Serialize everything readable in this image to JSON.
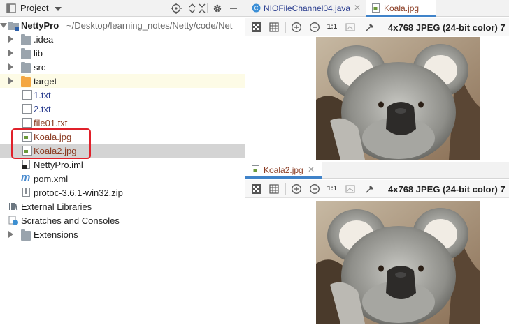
{
  "project_panel": {
    "title": "Project",
    "root_name": "NettyPro",
    "root_path": "~/Desktop/learning_notes/Netty/code/Net",
    "items": [
      {
        "label": "target",
        "kind": "folder-orange"
      },
      {
        "label": ".idea",
        "kind": "folder"
      },
      {
        "label": "lib",
        "kind": "folder"
      },
      {
        "label": "src",
        "kind": "folder"
      },
      {
        "label": "1.txt",
        "kind": "text"
      },
      {
        "label": "2.txt",
        "kind": "text"
      },
      {
        "label": "file01.txt",
        "kind": "text"
      },
      {
        "label": "Koala.jpg",
        "kind": "image"
      },
      {
        "label": "Koala2.jpg",
        "kind": "image"
      },
      {
        "label": "NettyPro.iml",
        "kind": "module"
      },
      {
        "label": "pom.xml",
        "kind": "maven"
      },
      {
        "label": "protoc-3.6.1-win32.zip",
        "kind": "archive"
      },
      {
        "label": "External Libraries",
        "kind": "libraries"
      },
      {
        "label": "Scratches and Consoles",
        "kind": "scratches"
      },
      {
        "label": "Extensions",
        "kind": "folder"
      }
    ]
  },
  "editor_top": {
    "tabs": [
      {
        "label": "NIOFileChannel04.java"
      },
      {
        "label": "Koala.jpg"
      }
    ],
    "toolbar": {
      "zoom_label": "1:1",
      "info": "4x768 JPEG (24-bit color) 7"
    }
  },
  "editor_bottom": {
    "tabs": [
      {
        "label": "Koala2.jpg"
      }
    ],
    "toolbar": {
      "zoom_label": "1:1",
      "info": "4x768 JPEG (24-bit color) 7"
    }
  },
  "colors": {
    "selection_bg": "#d4d4d4",
    "highlight_bg": "#fdfbe6",
    "annotation_border": "#e0202a",
    "blue_text": "#2a3d8f",
    "brown_text": "#8a3b22",
    "accent": "#4083c9"
  }
}
